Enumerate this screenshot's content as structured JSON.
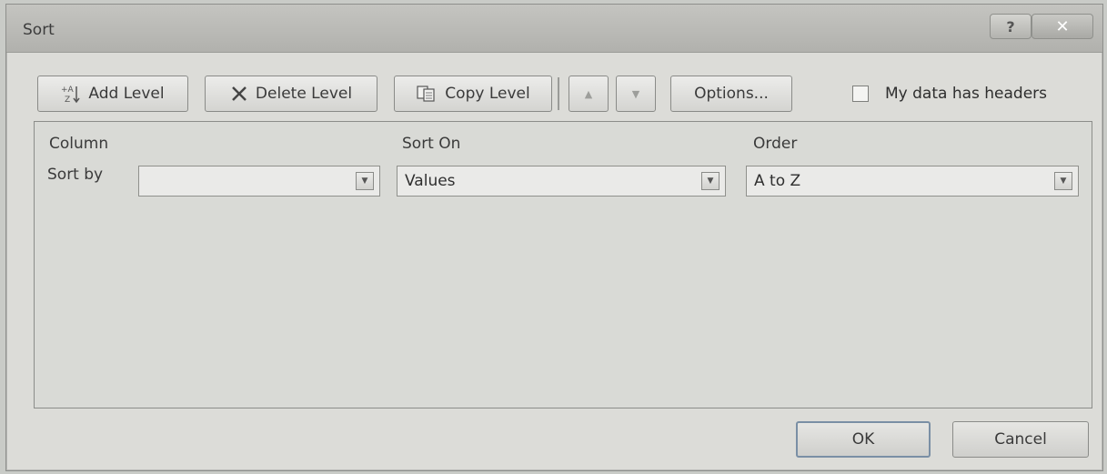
{
  "window": {
    "title": "Sort",
    "help_label": "?",
    "close_label": "✕"
  },
  "toolbar": {
    "add_level": "Add Level",
    "delete_level": "Delete Level",
    "copy_level": "Copy Level",
    "move_up_icon": "▲",
    "move_down_icon": "▼",
    "options": "Options...",
    "headers_checkbox_label": "My data has headers",
    "headers_checked": false
  },
  "grid": {
    "headers": {
      "column": "Column",
      "sort_on": "Sort On",
      "order": "Order"
    },
    "rows": [
      {
        "label": "Sort by",
        "column_value": "",
        "sort_on_value": "Values",
        "order_value": "A to Z"
      }
    ]
  },
  "footer": {
    "ok": "OK",
    "cancel": "Cancel"
  },
  "icons": {
    "add_level": "sort-add-icon",
    "delete_level": "x-icon",
    "copy_level": "copy-icon",
    "dropdown": "chevron-down-icon"
  }
}
